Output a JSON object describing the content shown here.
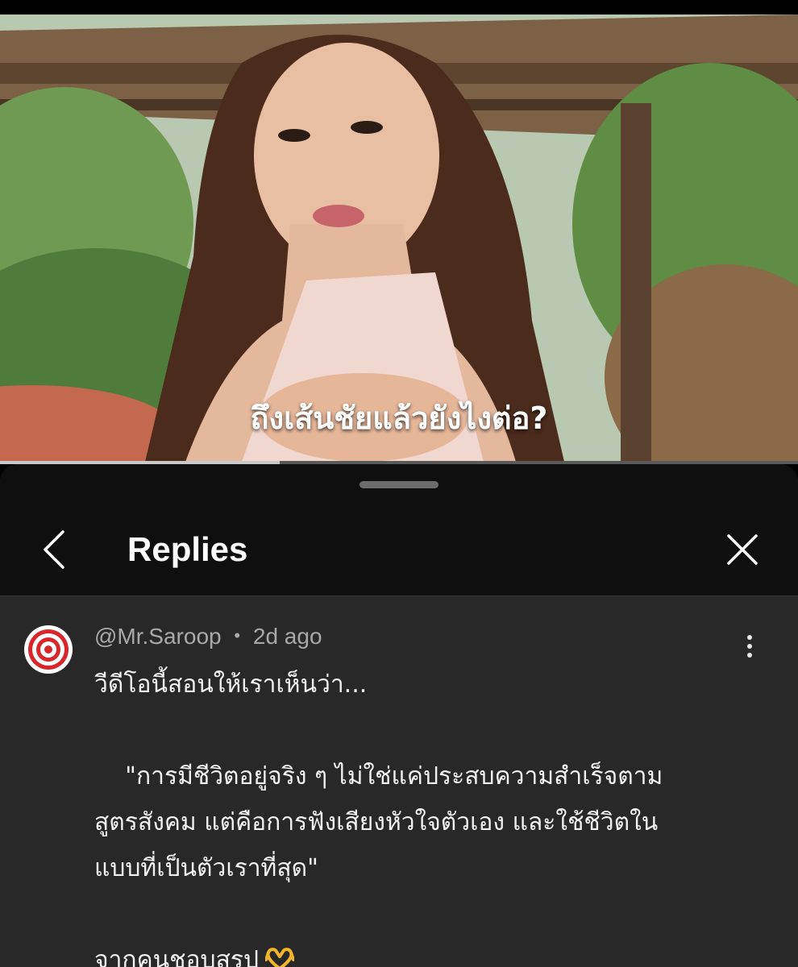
{
  "video": {
    "caption": "ถึงเส้นชัยแล้วยังไงต่อ?",
    "progress_fraction": 0.35
  },
  "sheet": {
    "title": "Replies"
  },
  "comment": {
    "author": "@Mr.Saroop",
    "separator": "•",
    "time": "2d ago",
    "lines": [
      "วีดีโอนี้สอนให้เราเห็นว่า...",
      "",
      "    \"การมีชีวิตอยู่จริง ๆ ไม่ใช่แค่ประสบความสำเร็จตาม",
      "สูตรสังคม แต่คือการฟังเสียงหัวใจตัวเอง และใช้ชีวิตใน",
      "แบบที่เป็นตัวเราที่สุด\"",
      "",
      "จากคนชอบสรุป"
    ]
  },
  "colors": {
    "sheet_bg": "#282828",
    "header_bg": "#0f0f0f",
    "meta_text": "#a9a9a9",
    "body_text": "#f1f1f1",
    "avatar_ring": "#d8262b"
  },
  "icons": {
    "back": "chevron-left-icon",
    "close": "close-icon",
    "more": "more-vertical-icon",
    "emoji": "heart-hands-emoji"
  }
}
